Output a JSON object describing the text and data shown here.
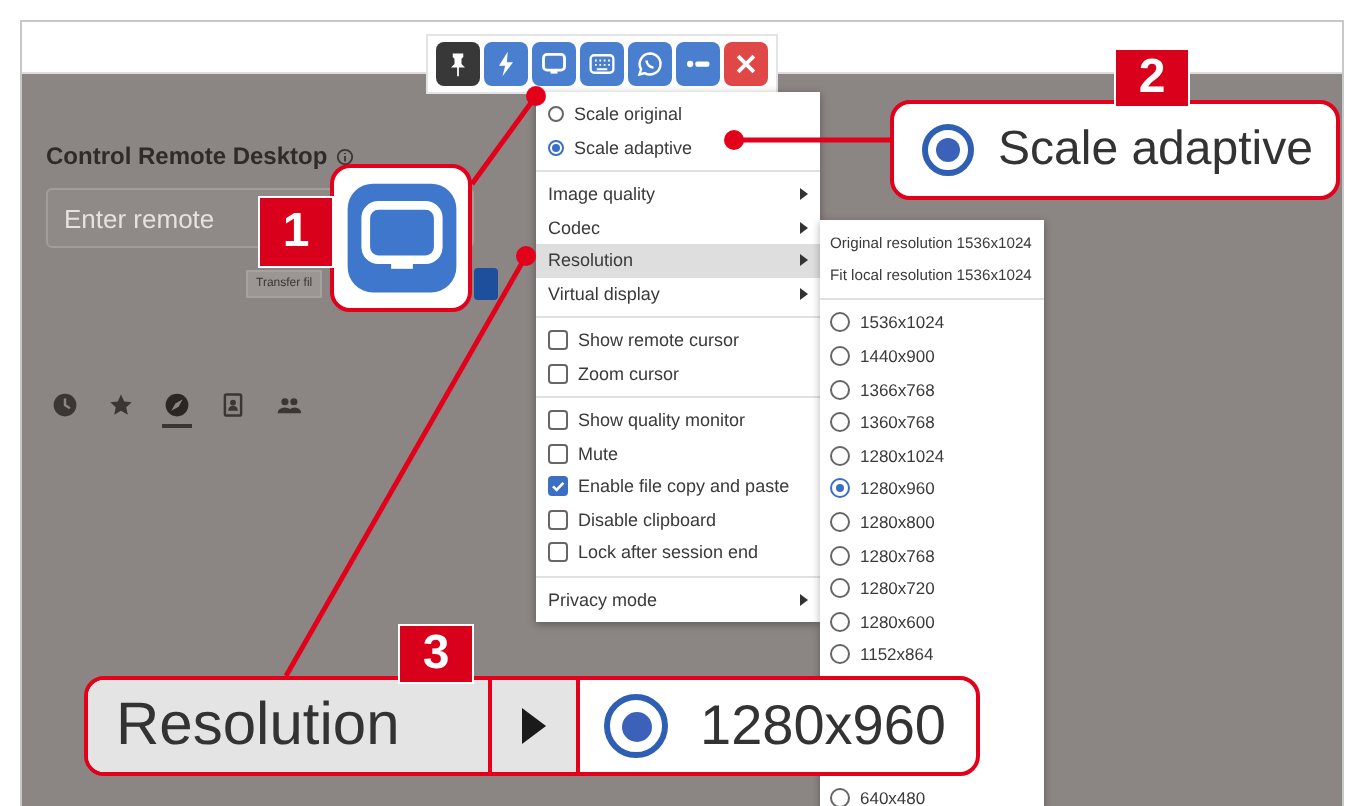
{
  "remote_panel": {
    "heading": "Control Remote Desktop",
    "id_field": {
      "placeholder": "Enter remote"
    },
    "transfer_button": "Transfer fil",
    "tabs": [
      {
        "kind": "clock",
        "selected": false
      },
      {
        "kind": "star",
        "selected": false
      },
      {
        "kind": "compass",
        "selected": true
      },
      {
        "kind": "book",
        "selected": false
      },
      {
        "kind": "people",
        "selected": false
      }
    ]
  },
  "toolbar": [
    {
      "kind": "pin"
    },
    {
      "kind": "bolt"
    },
    {
      "kind": "monitor"
    },
    {
      "kind": "keyboard"
    },
    {
      "kind": "chat"
    },
    {
      "kind": "record"
    },
    {
      "kind": "close"
    }
  ],
  "menu": {
    "items": [
      {
        "kind": "radio",
        "label": "Scale original",
        "selected": false
      },
      {
        "kind": "radio",
        "label": "Scale adaptive",
        "selected": true
      },
      {
        "kind": "separator"
      },
      {
        "kind": "submenu",
        "label": "Image quality",
        "highlighted": false
      },
      {
        "kind": "submenu",
        "label": "Codec",
        "highlighted": false
      },
      {
        "kind": "submenu",
        "label": "Resolution",
        "highlighted": true
      },
      {
        "kind": "submenu",
        "label": "Virtual display",
        "highlighted": false
      },
      {
        "kind": "separator"
      },
      {
        "kind": "check",
        "label": "Show remote cursor",
        "checked": false
      },
      {
        "kind": "check",
        "label": "Zoom cursor",
        "checked": false
      },
      {
        "kind": "separator"
      },
      {
        "kind": "check",
        "label": "Show quality monitor",
        "checked": false
      },
      {
        "kind": "check",
        "label": "Mute",
        "checked": false
      },
      {
        "kind": "check",
        "label": "Enable file copy and paste",
        "checked": true
      },
      {
        "kind": "check",
        "label": "Disable clipboard",
        "checked": false
      },
      {
        "kind": "check",
        "label": "Lock after session end",
        "checked": false
      },
      {
        "kind": "separator"
      },
      {
        "kind": "submenu",
        "label": "Privacy mode",
        "highlighted": false
      }
    ]
  },
  "resolution_menu": {
    "items": [
      {
        "kind": "action",
        "label": "Original resolution 1536x1024"
      },
      {
        "kind": "action",
        "label": "Fit local resolution 1536x1024"
      },
      {
        "kind": "separator"
      },
      {
        "kind": "radio",
        "label": "1536x1024",
        "selected": false
      },
      {
        "kind": "radio",
        "label": "1440x900",
        "selected": false
      },
      {
        "kind": "radio",
        "label": "1366x768",
        "selected": false
      },
      {
        "kind": "radio",
        "label": "1360x768",
        "selected": false
      },
      {
        "kind": "radio",
        "label": "1280x1024",
        "selected": false
      },
      {
        "kind": "radio",
        "label": "1280x960",
        "selected": true
      },
      {
        "kind": "radio",
        "label": "1280x800",
        "selected": false
      },
      {
        "kind": "radio",
        "label": "1280x768",
        "selected": false
      },
      {
        "kind": "radio",
        "label": "1280x720",
        "selected": false
      },
      {
        "kind": "radio",
        "label": "1280x600",
        "selected": false
      },
      {
        "kind": "radio",
        "label": "1152x864",
        "selected": false
      },
      {
        "kind": "radio",
        "label": "640x480",
        "selected": false
      }
    ]
  },
  "callouts": [
    {
      "number": "1",
      "kind": "icon"
    },
    {
      "number": "2",
      "kind": "radio",
      "label": "Scale adaptive",
      "selected": true
    },
    {
      "number": "3",
      "kind": "path",
      "label": "Resolution",
      "value": "1280x960",
      "selected": true
    }
  ]
}
